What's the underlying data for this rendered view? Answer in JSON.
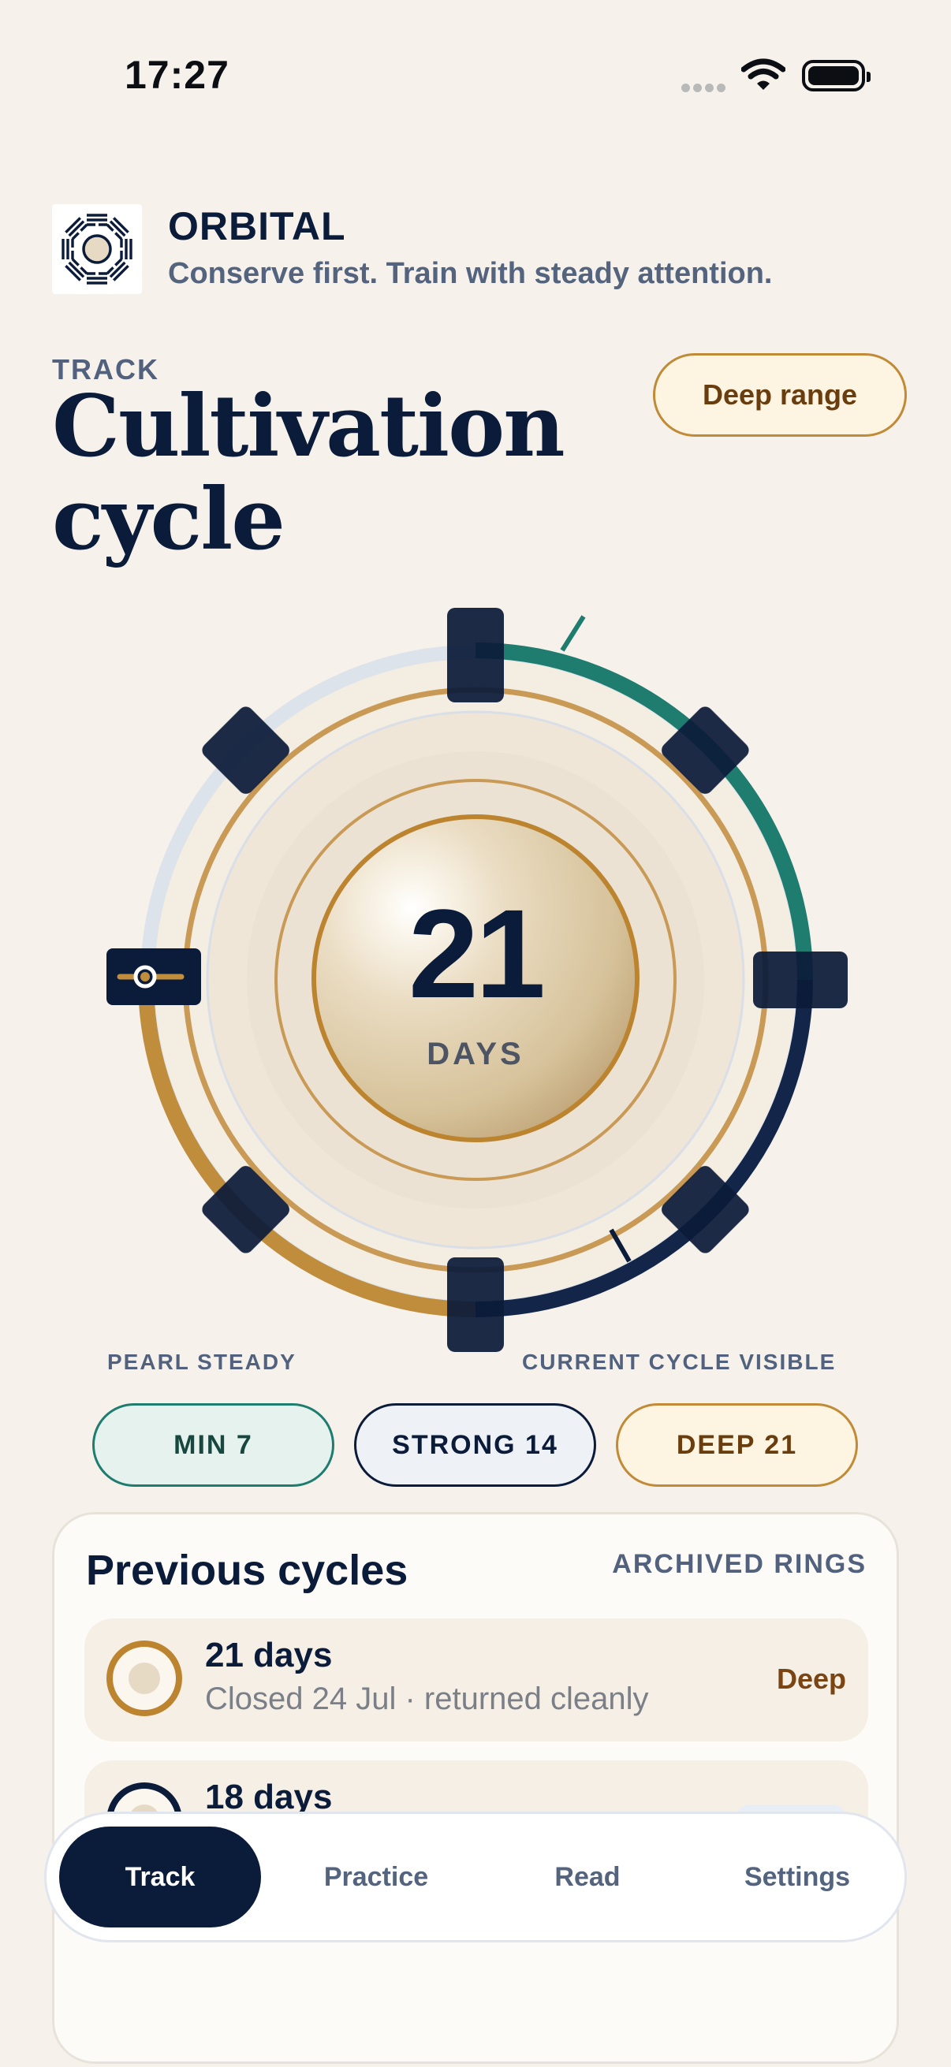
{
  "status": {
    "time": "17:27"
  },
  "brand": {
    "name": "ORBITAL",
    "tagline": "Conserve first. Train with steady attention."
  },
  "header": {
    "kicker": "TRACK",
    "title": "Cultivation cycle",
    "range_pill": "Deep range"
  },
  "cycle": {
    "count": "21",
    "unit": "DAYS",
    "progress_fraction": 0.25,
    "caption_left": "PEARL STEADY",
    "caption_right": "CURRENT CYCLE VISIBLE",
    "colors": {
      "teal": "#1f7d6f",
      "navy": "#0b1b3a",
      "gold": "#bd8430"
    }
  },
  "chips": {
    "min": "MIN 7",
    "strong": "STRONG 14",
    "deep": "DEEP 21"
  },
  "previous": {
    "title": "Previous cycles",
    "meta": "ARCHIVED RINGS",
    "rows": [
      {
        "days": "21 days",
        "note": "Closed 24 Jul · returned cleanly",
        "tag": "Deep"
      },
      {
        "days": "18 days",
        "note": "",
        "tag": ""
      }
    ]
  },
  "tabs": {
    "track": "Track",
    "practice": "Practice",
    "read": "Read",
    "settings": "Settings"
  }
}
